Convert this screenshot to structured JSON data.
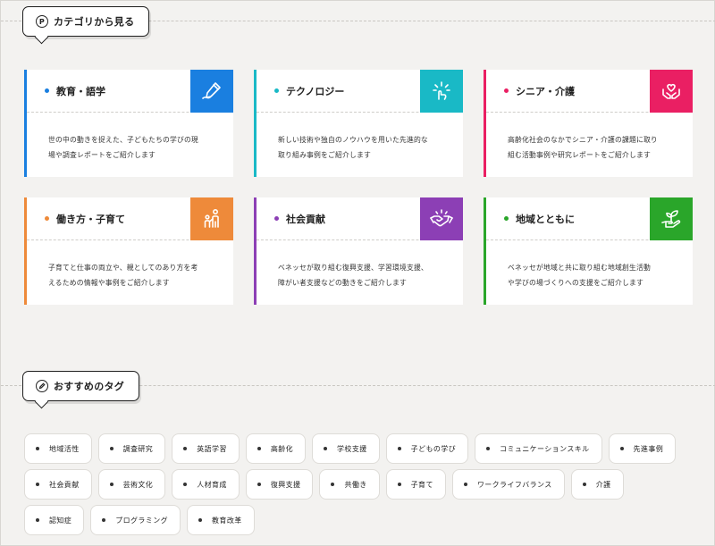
{
  "category_section": {
    "heading": "カテゴリから見る",
    "icon": "p-circle-icon"
  },
  "categories": [
    {
      "title": "教育・語学",
      "color": "#1a7fe0",
      "icon": "pen-hand-icon",
      "desc_line1": "世の中の動きを捉えた、子どもたちの学びの現",
      "desc_line2": "場や調査レポートをご紹介します"
    },
    {
      "title": "テクノロジー",
      "color": "#19b9c6",
      "icon": "sparkle-hand-icon",
      "desc_line1": "新しい技術や独自のノウハウを用いた先進的な",
      "desc_line2": "取り組み事例をご紹介します"
    },
    {
      "title": "シニア・介護",
      "color": "#ea1f63",
      "icon": "heart-hands-icon",
      "desc_line1": "高齢化社会のなかでシニア・介護の課題に取り",
      "desc_line2": "組む活動事例や研究レポートをご紹介します"
    },
    {
      "title": "働き方・子育て",
      "color": "#ee8a3a",
      "icon": "parent-child-icon",
      "desc_line1": "子育てと仕事の両立や、親としてのあり方を考",
      "desc_line2": "えるための情報や事例をご紹介します"
    },
    {
      "title": "社会貢献",
      "color": "#8c3fb5",
      "icon": "handshake-icon",
      "desc_line1": "ベネッセが取り組む復興支援、学習環境支援、",
      "desc_line2": "障がい者支援などの動きをご紹介します"
    },
    {
      "title": "地域とともに",
      "color": "#2aa62a",
      "icon": "plant-hand-icon",
      "desc_line1": "ベネッセが地域と共に取り組む地域創生活動",
      "desc_line2": "や学びの場づくりへの支援をご紹介します"
    }
  ],
  "tag_section": {
    "heading": "おすすめのタグ",
    "icon": "pencil-circle-icon"
  },
  "tags": [
    "地域活性",
    "調査研究",
    "英語学習",
    "高齢化",
    "学校支援",
    "子どもの学び",
    "コミュニケーションスキル",
    "先進事例",
    "社会貢献",
    "芸術文化",
    "人材育成",
    "復興支援",
    "共働き",
    "子育て",
    "ワークライフバランス",
    "介護",
    "認知症",
    "プログラミング",
    "教育改革"
  ]
}
